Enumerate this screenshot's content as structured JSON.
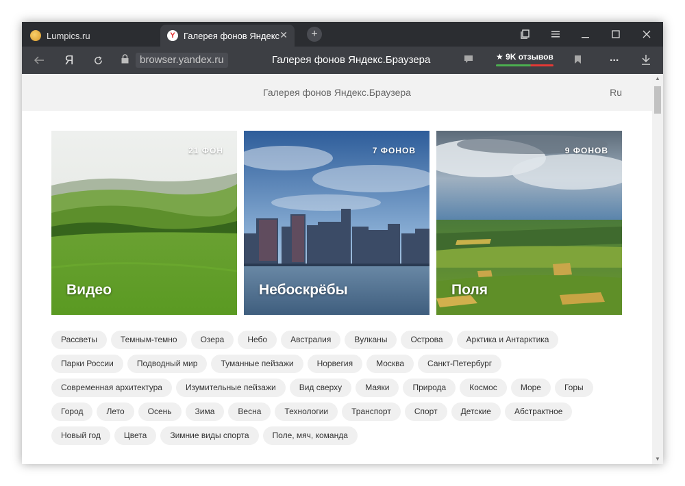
{
  "tabs": [
    {
      "title": "Lumpics.ru",
      "active": false
    },
    {
      "title": "Галерея фонов Яндекс.Браузера",
      "active": true
    }
  ],
  "window_controls": {
    "bookmarks_icon": "bookmarks-panel-icon",
    "menu_icon": "hamburger-menu-icon"
  },
  "address_bar": {
    "host": "browser.yandex.ru",
    "page_title": "Галерея фонов Яндекс.Браузера",
    "reviews": "★ 9K отзывов",
    "more": "..."
  },
  "header": {
    "title": "Галерея фонов Яндекс.Браузера",
    "lang": "Ru"
  },
  "cards": [
    {
      "name": "Видео",
      "count": "21 ФОН"
    },
    {
      "name": "Небоскрёбы",
      "count": "7 ФОНОВ"
    },
    {
      "name": "Поля",
      "count": "9 ФОНОВ"
    }
  ],
  "tags": [
    [
      "Рассветы",
      "Темным-темно",
      "Озера",
      "Небо",
      "Австралия",
      "Вулканы",
      "Острова",
      "Арктика и Антарктика"
    ],
    [
      "Парки России",
      "Подводный мир",
      "Туманные пейзажи",
      "Норвегия",
      "Москва",
      "Санкт-Петербург"
    ],
    [
      "Современная архитектура",
      "Изумительные пейзажи",
      "Вид сверху",
      "Маяки",
      "Природа",
      "Космос",
      "Море",
      "Горы"
    ],
    [
      "Город",
      "Лето",
      "Осень",
      "Зима",
      "Весна",
      "Технологии",
      "Транспорт",
      "Спорт",
      "Детские",
      "Абстрактное"
    ],
    [
      "Новый год",
      "Цвета",
      "Зимние виды спорта",
      "Поле, мяч, команда"
    ]
  ]
}
